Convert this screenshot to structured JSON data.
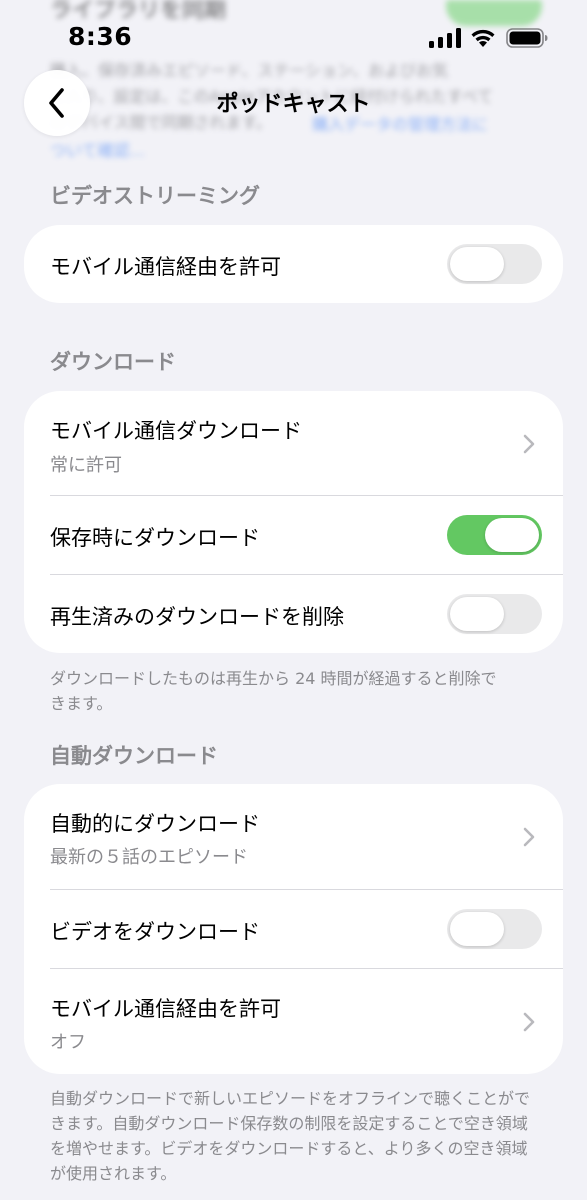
{
  "background": {
    "title": "ライブラリを同期",
    "text_line1": "購入、保存済みエピソード、ステーション、およびお気",
    "text_line2": "に入り、設定は、このAppleアカウントに紐付けられたすべて",
    "text_line3": "のデバイス間で同期されます。",
    "link": "購入データの管理方法に",
    "link_line2": "ついて確認..."
  },
  "status_bar": {
    "time": "8:36",
    "icons": [
      "signal-icon",
      "wifi-icon",
      "battery-icon"
    ]
  },
  "nav": {
    "back_icon": "chevron-left-icon",
    "title": "ポッドキャスト"
  },
  "sections": {
    "video_streaming": {
      "header": "ビデオストリーミング",
      "rows": [
        {
          "title": "モバイル通信経由を許可",
          "toggle": "off"
        }
      ]
    },
    "downloads": {
      "header": "ダウンロード",
      "rows": [
        {
          "title": "モバイル通信ダウンロード",
          "subtitle": "常に許可",
          "accessory": "chevron-right-icon"
        },
        {
          "title": "保存時にダウンロード",
          "toggle": "on"
        },
        {
          "title": "再生済みのダウンロードを削除",
          "toggle": "off"
        }
      ],
      "footnote": "ダウンロードしたものは再生から 24 時間が経過すると削除できます。"
    },
    "auto_downloads": {
      "header": "自動ダウンロード",
      "rows": [
        {
          "title": "自動的にダウンロード",
          "subtitle": "最新の５話のエピソード",
          "accessory": "chevron-right-icon"
        },
        {
          "title": "ビデオをダウンロード",
          "toggle": "off"
        },
        {
          "title": "モバイル通信経由を許可",
          "subtitle": "オフ",
          "accessory": "chevron-right-icon"
        }
      ],
      "footnote": "自動ダウンロードで新しいエピソードをオフラインで聴くことができます。自動ダウンロード保存数の制限を設定することで空き領域を増やせます。ビデオをダウンロードすると、より多くの空き領域が使用されます。"
    }
  },
  "colors": {
    "background": "#f2f2f7",
    "toggle_on": "#63c862",
    "toggle_off": "#e9e9ea",
    "secondary_text": "#8a8a8e",
    "link": "#3478f6"
  }
}
